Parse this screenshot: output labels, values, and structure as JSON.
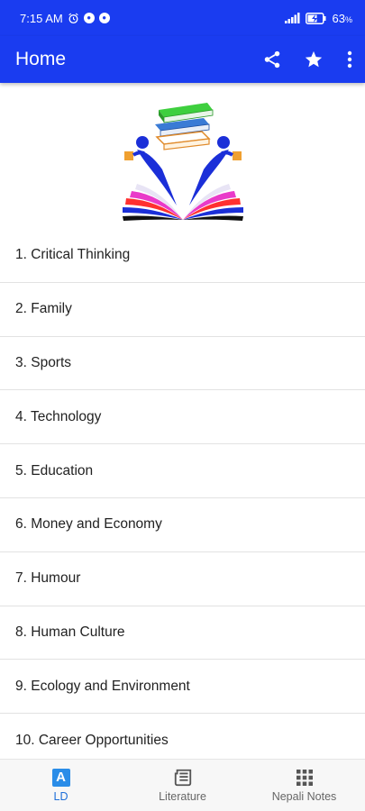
{
  "status_bar": {
    "time": "7:15 AM",
    "battery_percent": "63",
    "battery_suffix": "%"
  },
  "app_bar": {
    "title": "Home",
    "actions": [
      "share-icon",
      "star-icon",
      "more-vert-icon"
    ]
  },
  "topics": [
    "1. Critical Thinking",
    "2. Family",
    "3. Sports",
    "4. Technology",
    "5. Education",
    "6. Money and Economy",
    "7. Humour",
    "8. Human Culture",
    "9. Ecology and Environment",
    "10. Career Opportunities"
  ],
  "bottom_nav": {
    "items": [
      {
        "label": "LD",
        "icon": "ld-letter-icon",
        "badge": "A",
        "active": true
      },
      {
        "label": "Literature",
        "icon": "newspaper-icon",
        "active": false
      },
      {
        "label": "Nepali Notes",
        "icon": "grid-icon",
        "active": false
      }
    ]
  },
  "colors": {
    "app_bar": "#1a3cf0",
    "active_tab": "#1e6fd9",
    "inactive_tab": "#666666"
  }
}
